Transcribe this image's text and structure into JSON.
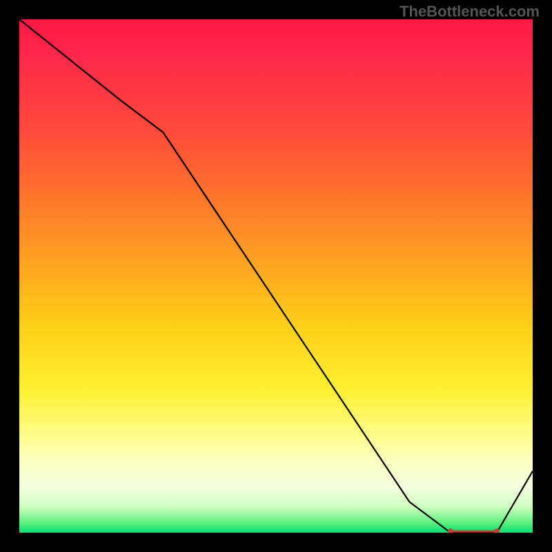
{
  "watermark": "TheBottleneck.com",
  "chart_data": {
    "type": "line",
    "title": "",
    "xlabel": "",
    "ylabel": "",
    "xlim": [
      0,
      100
    ],
    "ylim": [
      0,
      100
    ],
    "x": [
      0,
      10,
      20,
      28,
      40,
      52,
      64,
      76,
      84,
      87,
      93,
      100
    ],
    "values": [
      100,
      92,
      84,
      78,
      60,
      42,
      24,
      6,
      0,
      0,
      0,
      12
    ],
    "optimal_band": {
      "start_x": 84,
      "end_x": 93,
      "y": 0
    },
    "gradient_top_color": "#ff1744",
    "gradient_bottom_color": "#00e070",
    "note": "Values are percentages read from the vertical gradient scale; curve descends from top-left, with a gentle break near x≈28, reaches 0 around x≈84–93 (flat red-dotted optimal zone), then rises toward bottom-right."
  }
}
